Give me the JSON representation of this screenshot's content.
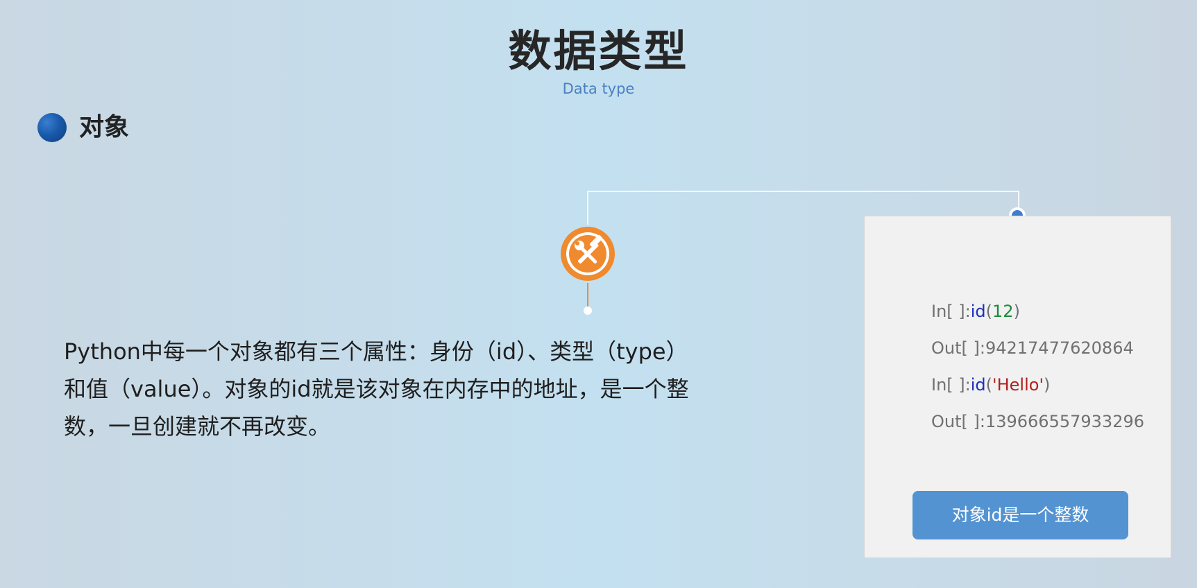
{
  "header": {
    "title": "数据类型",
    "subtitle": "Data type"
  },
  "section": {
    "title": "对象"
  },
  "icon": {
    "name": "tools-icon",
    "color": "#f08a2e"
  },
  "body": {
    "lines": [
      "Python中每一个对象都有三个属性：身份（id）、类型（type）",
      "和值（value）。对象的id就是该对象在内存中的地址，是一个整",
      "数，一旦创建就不再改变。"
    ]
  },
  "card": {
    "code": [
      {
        "prompt": "In[ ]:",
        "func": "id",
        "open": "(",
        "arg": "12",
        "close": ")"
      },
      {
        "prompt": "Out[ ]:",
        "value": "94217477620864"
      },
      {
        "prompt": "In[ ]:",
        "func": "id",
        "open": "(",
        "arg": "'Hello'",
        "close": ")"
      },
      {
        "prompt": "Out[ ]:",
        "value": "139666557933296"
      }
    ],
    "button_label": "对象id是一个整数"
  },
  "colors": {
    "accent": "#5393d2",
    "title": "#262626",
    "subtitle": "#4a7fc0",
    "icon": "#f08a2e",
    "connector_dot": "#3f7ccc"
  }
}
